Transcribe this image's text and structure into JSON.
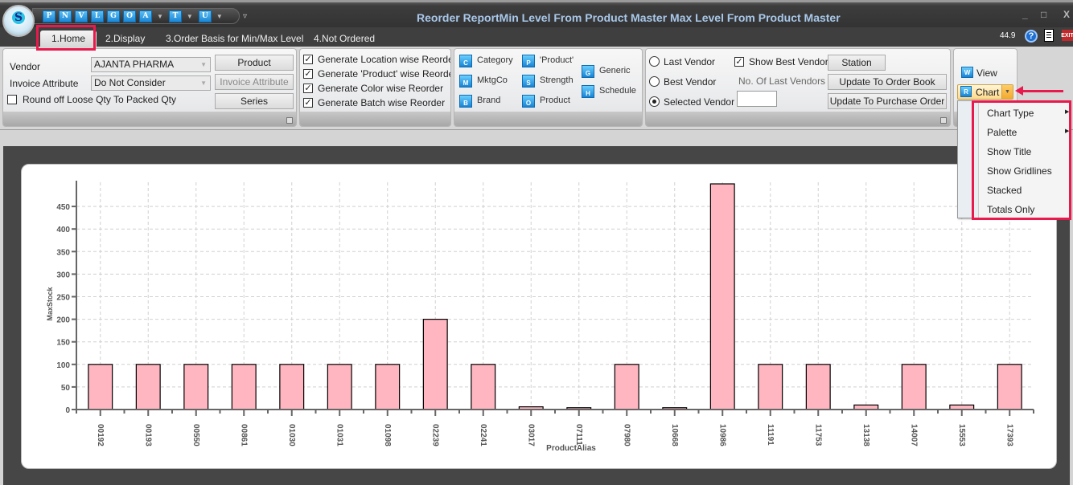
{
  "window": {
    "title": "Reorder ReportMin Level From Product Master Max Level From Product Master",
    "minimize": "_",
    "maximize": "□",
    "close": "X"
  },
  "logo": {
    "glyph": "S"
  },
  "quick_access": [
    {
      "label": "P",
      "has_menu": false
    },
    {
      "label": "N",
      "has_menu": false
    },
    {
      "label": "V",
      "has_menu": false
    },
    {
      "label": "L",
      "has_menu": false
    },
    {
      "label": "G",
      "has_menu": false
    },
    {
      "label": "O",
      "has_menu": false
    },
    {
      "label": "A",
      "has_menu": true
    },
    {
      "label": "T",
      "has_menu": true
    },
    {
      "label": "U",
      "has_menu": true
    }
  ],
  "quick_access_more": "▿",
  "tabs": [
    {
      "label": "1.Home",
      "active": true
    },
    {
      "label": "2.Display",
      "active": false
    },
    {
      "label": "3.Order Basis for Min/Max Level",
      "active": false
    },
    {
      "label": "4.Not Ordered",
      "active": false
    }
  ],
  "status": {
    "zoom": "44.9",
    "help_icon": "?",
    "exit_icon": "EXIT"
  },
  "ribbon": {
    "vendor_group": {
      "vendor_label": "Vendor",
      "vendor_value": "AJANTA PHARMA",
      "invoice_attr_label": "Invoice Attribute",
      "invoice_attr_value": "Do Not Consider",
      "round_off_label": "Round off Loose Qty To Packed Qty",
      "round_off_checked": false,
      "product_button": "Product",
      "invoice_attr_button": "Invoice Attribute",
      "series_button": "Series"
    },
    "generate_group": [
      {
        "label": "Generate Location wise Reorder",
        "checked": true
      },
      {
        "label": "Generate 'Product' wise Reorder",
        "checked": true
      },
      {
        "label": "Generate Color wise Reorder",
        "checked": true
      },
      {
        "label": "Generate Batch wise Reorder",
        "checked": true
      }
    ],
    "master_group": [
      {
        "label": "Category",
        "icon": "C"
      },
      {
        "label": "MktgCo",
        "icon": "M"
      },
      {
        "label": "Brand",
        "icon": "B"
      },
      {
        "label": "'Product'",
        "icon": "P"
      },
      {
        "label": "Strength",
        "icon": "S"
      },
      {
        "label": "Product",
        "icon": "O"
      },
      {
        "label": "Generic",
        "icon": "G"
      },
      {
        "label": "Schedule",
        "icon": "H"
      }
    ],
    "vendor_options": {
      "radios": [
        {
          "label": "Last Vendor",
          "selected": false
        },
        {
          "label": "Best Vendor",
          "selected": false
        },
        {
          "label": "Selected Vendor",
          "selected": true
        }
      ],
      "show_best_vendor_label": "Show Best Vendor",
      "show_best_vendor_checked": true,
      "last_vendors_label": "No. Of Last Vendors",
      "last_vendors_value": "",
      "station_button": "Station",
      "update_order_book_button": "Update To Order Book",
      "update_po_button": "Update To Purchase Order"
    },
    "view_group": {
      "view_label": "View",
      "chart_label": "Chart"
    }
  },
  "chart_menu": [
    {
      "label": "Chart Type",
      "submenu": true
    },
    {
      "label": "Palette",
      "submenu": true
    },
    {
      "label": "Show Title",
      "submenu": false
    },
    {
      "label": "Show Gridlines",
      "submenu": false
    },
    {
      "label": "Stacked",
      "submenu": false
    },
    {
      "label": "Totals Only",
      "submenu": false
    }
  ],
  "colors": {
    "highlight": "#e8194d",
    "bar_fill": "#ffb6c1",
    "bar_stroke": "#000000",
    "title_text": "#a9c8ea"
  },
  "chart_data": {
    "type": "bar",
    "title": "",
    "xlabel": "ProductAlias",
    "ylabel": "MaxStock",
    "categories": [
      "00192",
      "00193",
      "00550",
      "00861",
      "01030",
      "01031",
      "01098",
      "02239",
      "02241",
      "03017",
      "07111",
      "07980",
      "10668",
      "10986",
      "11191",
      "11753",
      "13138",
      "14007",
      "15553",
      "17393"
    ],
    "values": [
      100,
      100,
      100,
      100,
      100,
      100,
      100,
      200,
      100,
      6,
      4,
      100,
      4,
      500,
      100,
      100,
      10,
      100,
      10,
      100
    ],
    "ylim": [
      0,
      500
    ],
    "yticks": [
      0,
      50,
      100,
      150,
      200,
      250,
      300,
      350,
      400,
      450
    ],
    "grid": true,
    "legend": "none"
  }
}
